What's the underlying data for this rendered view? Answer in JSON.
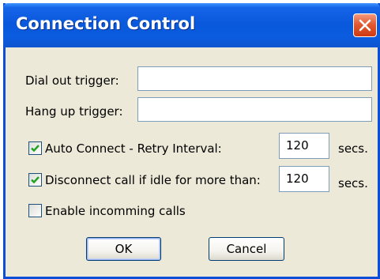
{
  "window": {
    "title": "Connection Control"
  },
  "form": {
    "dial_out_label": "Dial out trigger:",
    "dial_out_value": "",
    "hang_up_label": "Hang up trigger:",
    "hang_up_value": "",
    "auto_connect": {
      "label": "Auto Connect - Retry Interval:",
      "checked": true,
      "value": "120",
      "unit": "secs."
    },
    "disconnect_idle": {
      "label": "Disconnect call if idle for more than:",
      "checked": true,
      "value": "120",
      "unit": "secs."
    },
    "incoming_calls": {
      "label": "Enable incomming calls",
      "checked": false
    }
  },
  "buttons": {
    "ok_label": "OK",
    "cancel_label": "Cancel"
  },
  "colors": {
    "titlebar": "#0a58dc",
    "dialog_face": "#ece9d8",
    "close_button": "#e35a33",
    "checkmark": "#21a121"
  },
  "icons": {
    "close": "close-icon",
    "check": "checkmark-icon"
  }
}
